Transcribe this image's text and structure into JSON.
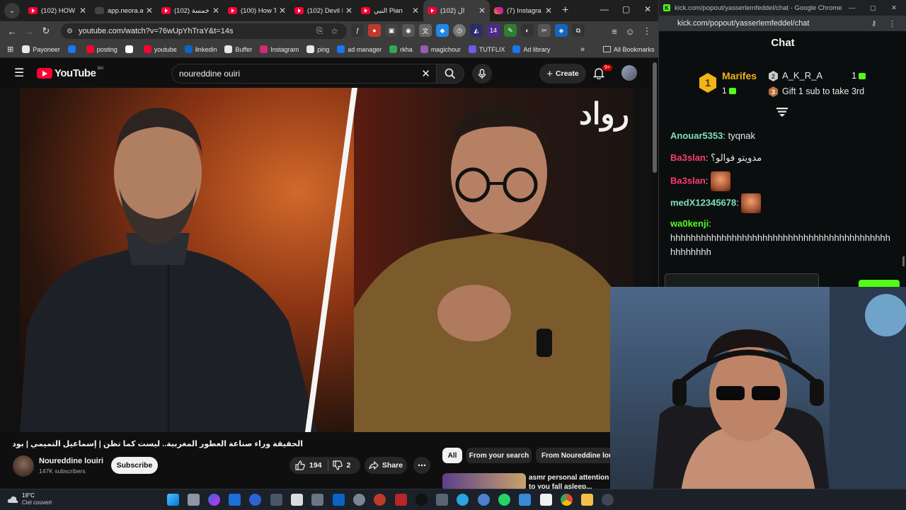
{
  "browser_left": {
    "tabs": [
      {
        "label": "(102) HOW",
        "icon": "youtube",
        "active": false
      },
      {
        "label": "app.neora.a",
        "icon": "neora",
        "active": false
      },
      {
        "label": "(102) خمسة",
        "icon": "youtube",
        "active": false
      },
      {
        "label": "(100) How T",
        "icon": "youtube",
        "active": false
      },
      {
        "label": "(102) Devil I",
        "icon": "youtube",
        "active": false
      },
      {
        "label": "النبي Pian",
        "icon": "youtube",
        "active": false
      },
      {
        "label": "(102) ال",
        "icon": "youtube",
        "active": true
      },
      {
        "label": "(7) Instagra",
        "icon": "instagram",
        "active": false
      }
    ],
    "url": "youtube.com/watch?v=76wUpYhTraY&t=14s",
    "bookmarks": [
      {
        "label": "Payoneer",
        "color": "#e8e8e8"
      },
      {
        "label": "",
        "color": "#1877f2"
      },
      {
        "label": "posting",
        "color": "#ff0033"
      },
      {
        "label": "",
        "color": "#ffffff"
      },
      {
        "label": "youtube",
        "color": "#ff0033"
      },
      {
        "label": "linkedin",
        "color": "#0a66c2"
      },
      {
        "label": "Buffer",
        "color": "#e8e8e8"
      },
      {
        "label": "Instagram",
        "color": "#d62976"
      },
      {
        "label": "ping",
        "color": "#e8e8e8"
      },
      {
        "label": "ad manager",
        "color": "#1877f2"
      },
      {
        "label": "rkha",
        "color": "#34a853"
      },
      {
        "label": "magichour",
        "color": "#9b59b6"
      },
      {
        "label": "TUTFLIX",
        "color": "#6c5ce7"
      },
      {
        "label": "Ad library",
        "color": "#1877f2"
      }
    ],
    "all_bookmarks": "All Bookmarks"
  },
  "youtube": {
    "logo_word": "YouTube",
    "country_code": "MA",
    "search_query": "noureddine ouiri",
    "create_label": "Create",
    "notifications": "9+",
    "watermark": "رواد",
    "video_title": "الحقيقة وراء صناعة العطور المغربية.. ليست كما تظن | إسماعيل التميمي | بودكاست رواد",
    "channel_name": "Noureddine louiri",
    "subscribers": "147K subscribers",
    "subscribe_label": "Subscribe",
    "likes": "194",
    "dislikes": "2",
    "share_label": "Share",
    "chips": [
      "All",
      "From your search",
      "From Noureddine louiri"
    ],
    "rec_title": "asmr personal attention to you fall asleep... (emily bla"
  },
  "chat": {
    "window_title": "kick.com/popout/yasserlemfeddel/chat - Google Chrome",
    "url": "kick.com/popout/yasserlemfeddel/chat",
    "header": "Chat",
    "leaderboard": {
      "first": {
        "rank": "1",
        "name": "Marifes",
        "count": "1"
      },
      "second": {
        "rank": "2",
        "name": "A_K_R_A",
        "count": "1"
      },
      "third": {
        "rank": "3",
        "text": "Gift 1 sub to take 3rd"
      }
    },
    "messages": [
      {
        "user": "Anouar5353",
        "color": "#7fe0b8",
        "text": "tyqnak"
      },
      {
        "user": "Ba3slan",
        "color": "#ff3a6e",
        "text": "مدويتو فوالو؟"
      },
      {
        "user": "Ba3slan",
        "color": "#ff3a6e",
        "text": ""
      },
      {
        "user": "medX12345678",
        "color": "#7fe0b8",
        "text": ""
      },
      {
        "user": "wa0kenji",
        "color": "#53fc18",
        "text": "hhhhhhhhhhhhhhhhhhhhhhhhhhhhhhhhhhhhhhhhhhhhhhhhhhh"
      }
    ],
    "colors": {
      "accent": "#53fc18",
      "gold": "#f2b418"
    }
  },
  "taskbar": {
    "temperature": "19°C",
    "condition": "Ciel couvert"
  }
}
